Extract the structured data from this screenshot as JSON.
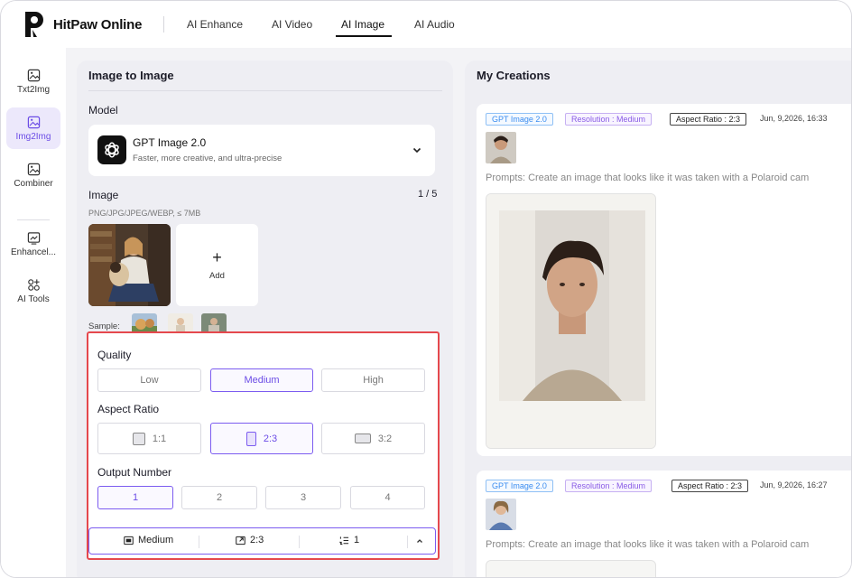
{
  "brand": {
    "name": "HitPaw Online"
  },
  "nav": {
    "items": [
      {
        "label": "AI Enhance"
      },
      {
        "label": "AI Video"
      },
      {
        "label": "AI Image"
      },
      {
        "label": "AI Audio"
      }
    ],
    "active": "AI Image"
  },
  "rail": {
    "items": [
      {
        "label": "Txt2Img",
        "icon": "image-icon"
      },
      {
        "label": "Img2Img",
        "icon": "image-icon"
      },
      {
        "label": "Combiner",
        "icon": "image-icon"
      },
      {
        "label": "Enhancel...",
        "icon": "enhance-icon"
      },
      {
        "label": "AI Tools",
        "icon": "tools-icon"
      }
    ],
    "active": "Img2Img"
  },
  "left_panel": {
    "title": "Image to Image",
    "model_label": "Model",
    "model": {
      "name": "GPT Image 2.0",
      "description": "Faster, more creative, and ultra-precise"
    },
    "image_label": "Image",
    "image_count": "1 / 5",
    "formats_hint": "PNG/JPG/JPEG/WEBP, ≤ 7MB",
    "add_label": "Add",
    "sample_label": "Sample:"
  },
  "settings": {
    "quality_label": "Quality",
    "quality_options": [
      "Low",
      "Medium",
      "High"
    ],
    "quality_selected": "Medium",
    "aspect_label": "Aspect Ratio",
    "aspect_options": [
      "1:1",
      "2:3",
      "3:2"
    ],
    "aspect_selected": "2:3",
    "output_label": "Output Number",
    "output_options": [
      "1",
      "2",
      "3",
      "4"
    ],
    "output_selected": "1",
    "summary": {
      "quality": "Medium",
      "aspect": "2:3",
      "count": "1"
    }
  },
  "creations": {
    "title": "My Creations",
    "cards": [
      {
        "model_tag": "GPT Image 2.0",
        "resolution_tag": "Resolution : Medium",
        "aspect_tag": "Aspect Ratio : 2:3",
        "date": "Jun, 9,2026, 16:33",
        "prompt": "Prompts: Create an image that looks like it was taken with a Polaroid cam"
      },
      {
        "model_tag": "GPT Image 2.0",
        "resolution_tag": "Resolution : Medium",
        "aspect_tag": "Aspect Ratio : 2:3",
        "date": "Jun, 9,2026, 16:27",
        "prompt": "Prompts: Create an image that looks like it was taken with a Polaroid cam"
      }
    ]
  },
  "colors": {
    "accent": "#6b4ce6",
    "highlight_border": "#e5484d",
    "tag_blue": "#3b8df0",
    "tag_purple": "#8a5ce6"
  }
}
